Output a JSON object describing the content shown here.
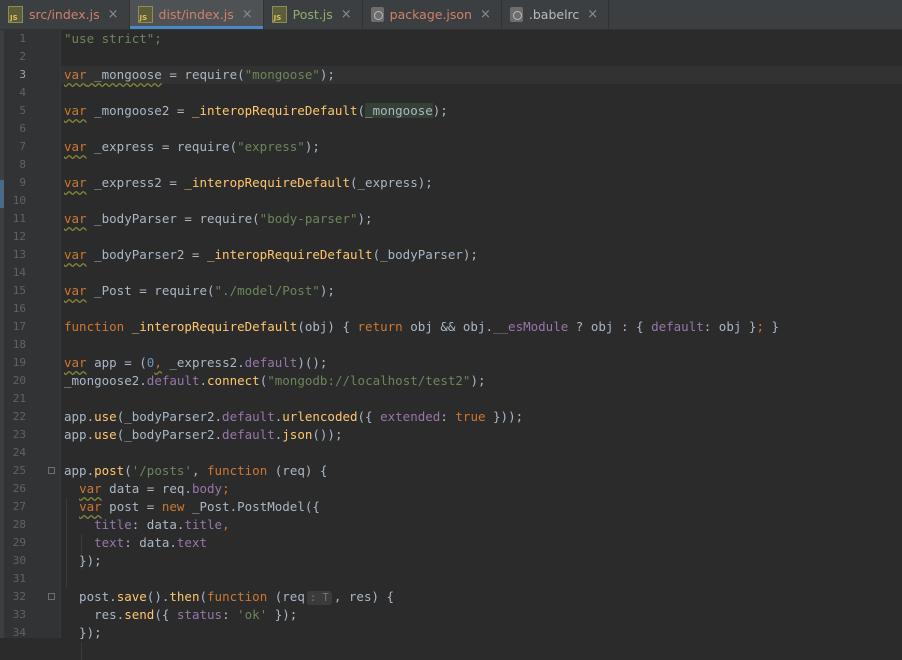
{
  "tabs": [
    {
      "name": "src/index.js",
      "icon": "js-file-icon",
      "active": false
    },
    {
      "name": "dist/index.js",
      "icon": "js-file-icon",
      "active": true
    },
    {
      "name": "Post.js",
      "icon": "js-file-icon",
      "active": false
    },
    {
      "name": "package.json",
      "icon": "config-file-icon",
      "active": false
    },
    {
      "name": ".babelrc",
      "icon": "config-file-icon",
      "active": false
    }
  ],
  "close_glyph": "×",
  "current_line": 3,
  "line_numbers": [
    "1",
    "2",
    "3",
    "4",
    "5",
    "6",
    "7",
    "8",
    "9",
    "10",
    "11",
    "12",
    "13",
    "14",
    "15",
    "16",
    "17",
    "18",
    "19",
    "20",
    "21",
    "22",
    "23",
    "24",
    "25",
    "26",
    "27",
    "28",
    "29",
    "30",
    "31",
    "32",
    "33",
    "34"
  ],
  "code": {
    "l1": [
      "\"use strict\";"
    ],
    "l3": [
      "var",
      " _mongoose",
      " = require(",
      "\"mongoose\"",
      ");"
    ],
    "l5": [
      "var",
      " _mongoose2 = ",
      "_interopRequireDefault",
      "(",
      "_mongoose",
      ");"
    ],
    "l7": [
      "var",
      " _express = require(",
      "\"express\"",
      ");"
    ],
    "l9": [
      "var",
      " _express2 = ",
      "_interopRequireDefault",
      "(_express);"
    ],
    "l11": [
      "var",
      " _bodyParser = require(",
      "\"body-parser\"",
      ");"
    ],
    "l13": [
      "var",
      " _bodyParser2 = ",
      "_interopRequireDefault",
      "(_bodyParser);"
    ],
    "l15": [
      "var",
      " _Post = require(",
      "\"./model/Post\"",
      ");"
    ],
    "l17": [
      "function ",
      "_interopRequireDefault",
      "(obj) { ",
      "return",
      " obj && obj.",
      "__esModule",
      " ? obj : { ",
      "default",
      ": obj }",
      ";",
      " }"
    ],
    "l19": [
      "var",
      " app = (",
      "0",
      ",",
      " _express2.",
      "default",
      ")();"
    ],
    "l20": [
      "_mongoose2.",
      "default",
      ".",
      "connect",
      "(",
      "\"mongodb://localhost/test2\"",
      ");"
    ],
    "l22": [
      "app.",
      "use",
      "(_bodyParser2.",
      "default",
      ".",
      "urlencoded",
      "({ ",
      "extended",
      ": ",
      "true",
      " }));"
    ],
    "l23": [
      "app.",
      "use",
      "(_bodyParser2.",
      "default",
      ".",
      "json",
      "());"
    ],
    "l25": [
      "app.",
      "post",
      "(",
      "'/posts'",
      ", ",
      "function",
      " (req) {"
    ],
    "l26": [
      "  ",
      "var",
      " data = req.",
      "body",
      ";"
    ],
    "l27": [
      "  ",
      "var",
      " post = ",
      "new",
      " _Post.",
      "PostModel",
      "({"
    ],
    "l28": [
      "    ",
      "title",
      ": data.",
      "title",
      ","
    ],
    "l29": [
      "    ",
      "text",
      ": data.",
      "text"
    ],
    "l30": [
      "  });"
    ],
    "l32": [
      "  post.",
      "save",
      "().",
      "then",
      "(",
      "function",
      " (req",
      ": T",
      ", res) {"
    ],
    "l33": [
      "    res.",
      "send",
      "({ ",
      "status",
      ": ",
      "'ok'",
      " });"
    ],
    "l34": [
      "  });"
    ]
  },
  "colors": {
    "keyword": "#cc7832",
    "string": "#6a8759",
    "function": "#ffc66d",
    "property": "#9876aa",
    "text": "#a9b7c6",
    "background": "#2b2b2b",
    "gutter": "#313335"
  }
}
